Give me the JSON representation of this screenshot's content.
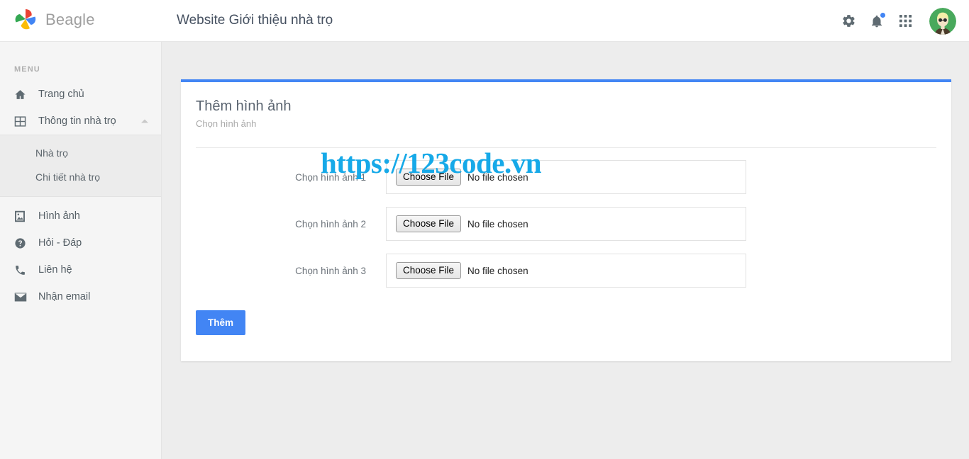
{
  "topbar": {
    "brand_name": "Beagle",
    "brand_logo_icon": "pinwheel-logo-icon",
    "app_title": "Website Giới thiệu nhà trọ",
    "icons": [
      {
        "name": "gear-icon",
        "label": "Cài đặt"
      },
      {
        "name": "bell-icon",
        "label": "Thông báo",
        "has_dot": true
      },
      {
        "name": "apps-grid-icon",
        "label": "Ứng dụng"
      }
    ],
    "avatar_label": "avatar",
    "accent_color": "#4285f4",
    "notification_dot_color": "#4285f4"
  },
  "sidebar": {
    "section_label": "MENU",
    "items": [
      {
        "label": "Trang chủ",
        "icon": "home-icon"
      },
      {
        "label": "Thông tin nhà trọ",
        "icon": "grid-table-icon",
        "expanded": true
      },
      {
        "label": "Hình ảnh",
        "icon": "image-icon"
      },
      {
        "label": "Hỏi - Đáp",
        "icon": "question-circle-icon"
      },
      {
        "label": "Liên hệ",
        "icon": "phone-icon"
      },
      {
        "label": "Nhận email",
        "icon": "envelope-icon"
      }
    ],
    "submenu": [
      {
        "label": "Nhà trọ"
      },
      {
        "label": "Chi tiết nhà trọ"
      }
    ]
  },
  "card": {
    "title": "Thêm hình ảnh",
    "subtitle": "Chọn hình ảnh",
    "top_border_color": "#4285f4",
    "form_rows": [
      {
        "label": "Chọn hình ảnh 1",
        "button_label": "Choose File",
        "file_status": "No file chosen"
      },
      {
        "label": "Chọn hình ảnh 2",
        "button_label": "Choose File",
        "file_status": "No file chosen"
      },
      {
        "label": "Chọn hình ảnh 3",
        "button_label": "Choose File",
        "file_status": "No file chosen"
      }
    ],
    "submit_label": "Thêm"
  },
  "watermark": {
    "text": "https://123code.vn",
    "color": "#16a9e8"
  }
}
